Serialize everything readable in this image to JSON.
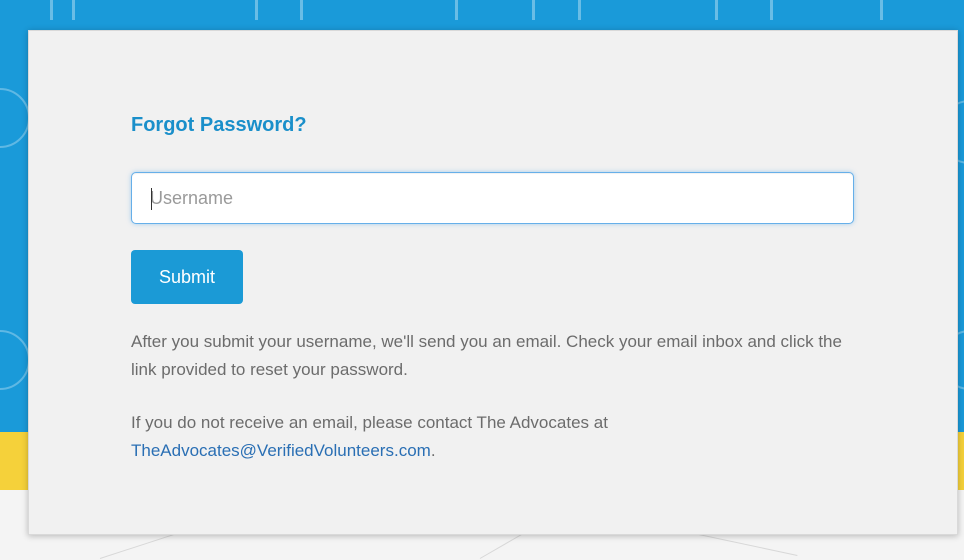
{
  "form": {
    "title": "Forgot Password?",
    "username_placeholder": "Username",
    "username_value": "",
    "submit_label": "Submit"
  },
  "info": {
    "paragraph1": "After you submit your username, we'll send you an email. Check your email inbox and click the link provided to reset your password.",
    "paragraph2_prefix": "If you do not receive an email, please contact The Advocates at ",
    "contact_email": "TheAdvocates@VerifiedVolunteers.com",
    "paragraph2_suffix": "."
  },
  "colors": {
    "background_blue": "#1a9ad9",
    "background_yellow": "#f5d13a",
    "title": "#1a8fca",
    "button": "#1b9ad6",
    "link": "#2a6fb4",
    "text": "#6c6c6c"
  }
}
